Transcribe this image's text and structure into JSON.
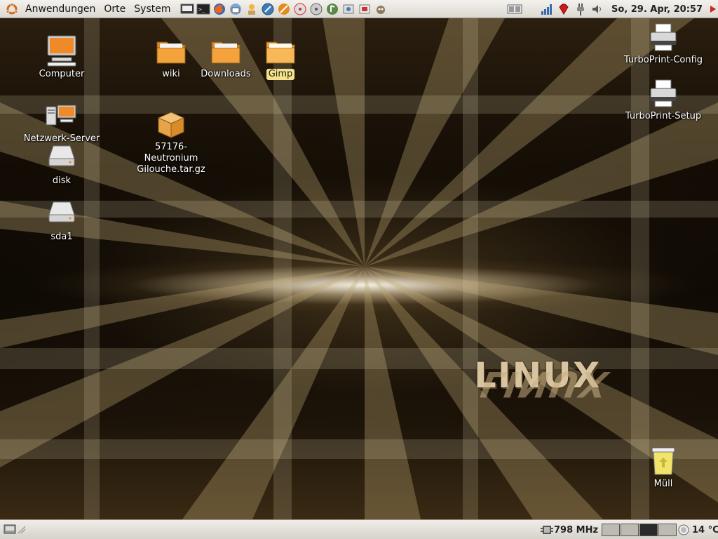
{
  "top_panel": {
    "menus": [
      "Anwendungen",
      "Orte",
      "System"
    ],
    "launchers": [
      "terminal-icon",
      "terminal-icon",
      "firefox-icon",
      "thunderbird-icon",
      "user-icon",
      "network-icon",
      "stripe-icon",
      "cd-icon",
      "cd-icon",
      "audio-icon",
      "package-icon",
      "package-icon",
      "gimp-icon"
    ],
    "clock": "So, 29. Apr, 20:57"
  },
  "bottom_panel": {
    "cpu_freq": "798 MHz",
    "temperature": "14 °C",
    "workspaces": 4,
    "active_workspace": 3
  },
  "desktop": {
    "icons_left": [
      {
        "label": "Computer"
      },
      {
        "label": "Netzwerk-Server"
      },
      {
        "label": "disk"
      },
      {
        "label": "sda1"
      }
    ],
    "folders": [
      {
        "label": "wiki"
      },
      {
        "label": "Downloads"
      },
      {
        "label": "Gimp",
        "selected": true
      }
    ],
    "archive": {
      "label": "57176-Neutronium\nGilouche.tar.gz"
    },
    "icons_right": [
      {
        "label": "TurboPrint-Config"
      },
      {
        "label": "TurboPrint-Setup"
      }
    ],
    "trash": {
      "label": "Müll"
    },
    "wallpaper_text": "LINUX"
  },
  "colors": {
    "panel_bg": "#e6e3dc",
    "selection_bg": "#f6e28a",
    "folder": "#f3a23c"
  }
}
